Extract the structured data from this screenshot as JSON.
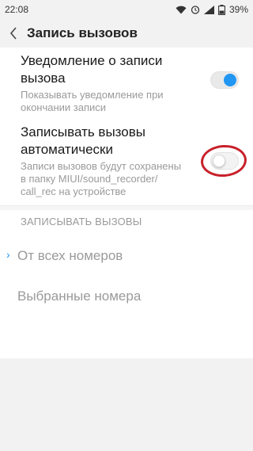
{
  "status": {
    "time": "22:08",
    "battery": "39%"
  },
  "header": {
    "title": "Запись вызовов"
  },
  "settings": [
    {
      "title_line1": "Уведомление о записи",
      "title_line2": "вызова",
      "desc_line1": "Показывать уведомление при",
      "desc_line2": "окончании записи",
      "enabled": true
    },
    {
      "title_line1": "Записывать вызовы",
      "title_line2": "автоматически",
      "desc_line1": "Записи вызовов будут сохранены",
      "desc_line2": "в папку MIUI/sound_recorder/",
      "desc_line3": "call_rec на устройстве",
      "enabled": false
    }
  ],
  "record_section": {
    "header": "ЗАПИСЫВАТЬ ВЫЗОВЫ",
    "options": [
      {
        "label": "От всех номеров",
        "selected": true
      },
      {
        "label": "Выбранные номера",
        "selected": false
      }
    ]
  },
  "colors": {
    "accent": "#2196f3",
    "highlight": "#c8202a"
  }
}
